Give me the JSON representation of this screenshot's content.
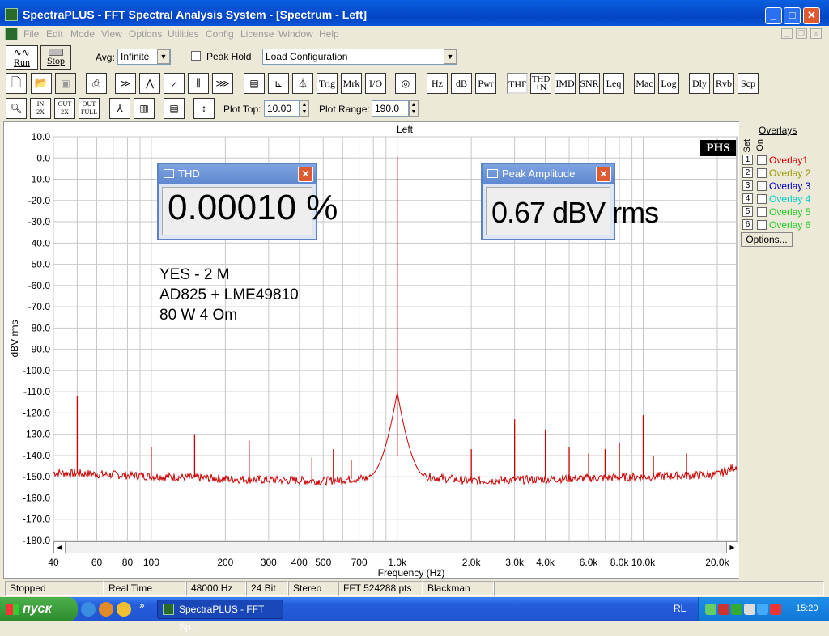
{
  "window": {
    "title": "SpectraPLUS - FFT Spectral Analysis System - [Spectrum - Left]",
    "minimize": "_",
    "maximize": "□",
    "close": "✕"
  },
  "menu": [
    "File",
    "Edit",
    "Mode",
    "View",
    "Options",
    "Utilities",
    "Config",
    "License",
    "Window",
    "Help"
  ],
  "toolbar1": {
    "run_label": "Run",
    "stop_label": "Stop",
    "avg_label": "Avg:",
    "avg_value": "Infinite",
    "peak_hold_label": "Peak Hold",
    "peak_hold_checked": false,
    "config_value": "Load Configuration"
  },
  "toolbar2": {
    "text_buttons": [
      "Trig",
      "Mrk",
      "I/O",
      "Hz",
      "dB",
      "Pwr",
      "THD",
      "IMD",
      "SNR",
      "Leq",
      "Mac",
      "Log",
      "Dly",
      "Rvb",
      "Scp"
    ],
    "thdn_line1": "THD",
    "thdn_line2": "+N"
  },
  "toolbar3": {
    "zoom_in": [
      "IN",
      "2X"
    ],
    "zoom_out": [
      "OUT",
      "2X"
    ],
    "zoom_full": [
      "OUT",
      "FULL"
    ],
    "plot_top_label": "Plot Top:",
    "plot_top_value": "10.00",
    "plot_range_label": "Plot Range:",
    "plot_range_value": "190.0"
  },
  "plot": {
    "channel_title": "Left",
    "badge": "PHS",
    "annotation": [
      "YES - 2 M",
      "AD825 + LME49810",
      "80 W   4 Om"
    ],
    "trace_color": "#cc0000"
  },
  "chart_data": {
    "type": "line",
    "title": "Left",
    "xlabel": "Frequency (Hz)",
    "ylabel": "dBV rms",
    "xscale": "log",
    "xlim": [
      40,
      24000
    ],
    "ylim": [
      -180,
      10
    ],
    "x_tick_labels": [
      {
        "v": 40,
        "t": "40"
      },
      {
        "v": 60,
        "t": "60"
      },
      {
        "v": 80,
        "t": "80"
      },
      {
        "v": 100,
        "t": "100"
      },
      {
        "v": 200,
        "t": "200"
      },
      {
        "v": 300,
        "t": "300"
      },
      {
        "v": 400,
        "t": "400"
      },
      {
        "v": 500,
        "t": "500"
      },
      {
        "v": 700,
        "t": "700"
      },
      {
        "v": 1000,
        "t": "1.0k"
      },
      {
        "v": 2000,
        "t": "2.0k"
      },
      {
        "v": 3000,
        "t": "3.0k"
      },
      {
        "v": 4000,
        "t": "4.0k"
      },
      {
        "v": 6000,
        "t": "6.0k"
      },
      {
        "v": 8000,
        "t": "8.0k"
      },
      {
        "v": 10000,
        "t": "10.0k"
      },
      {
        "v": 20000,
        "t": "20.0k"
      }
    ],
    "y_ticks": [
      10,
      0,
      -10,
      -20,
      -30,
      -40,
      -50,
      -60,
      -70,
      -80,
      -90,
      -100,
      -110,
      -120,
      -130,
      -140,
      -150,
      -160,
      -170,
      -180
    ],
    "y_tick_labels": [
      "10.0",
      "0.0",
      "-10.0",
      "-20.0",
      "-30.0",
      "-40.0",
      "-50.0",
      "-60.0",
      "-70.0",
      "-80.0",
      "-90.0",
      "-100.0",
      "-110.0",
      "-120.0",
      "-130.0",
      "-140.0",
      "-150.0",
      "-160.0",
      "-170.0",
      "-180.0"
    ],
    "noise_floor": [
      [
        40,
        -148
      ],
      [
        200,
        -151
      ],
      [
        500,
        -152
      ],
      [
        900,
        -150
      ],
      [
        1000,
        -140
      ],
      [
        1100,
        -149
      ],
      [
        2000,
        -152
      ],
      [
        10000,
        -150
      ],
      [
        20000,
        -149
      ],
      [
        24000,
        -145
      ]
    ],
    "peaks": [
      {
        "x": 50,
        "y": -112
      },
      {
        "x": 100,
        "y": -136
      },
      {
        "x": 150,
        "y": -130
      },
      {
        "x": 250,
        "y": -133
      },
      {
        "x": 450,
        "y": -141
      },
      {
        "x": 550,
        "y": -137
      },
      {
        "x": 650,
        "y": -142
      },
      {
        "x": 1000,
        "y": 0.7
      },
      {
        "x": 2000,
        "y": -137
      },
      {
        "x": 3000,
        "y": -123
      },
      {
        "x": 4000,
        "y": -128
      },
      {
        "x": 5000,
        "y": -136
      },
      {
        "x": 6000,
        "y": -139
      },
      {
        "x": 7000,
        "y": -137
      },
      {
        "x": 8000,
        "y": -134
      },
      {
        "x": 10000,
        "y": -121
      },
      {
        "x": 11000,
        "y": -140
      },
      {
        "x": 15000,
        "y": -139
      }
    ]
  },
  "overlays": {
    "title": "Overlays",
    "set_label": "Set",
    "on_label": "On",
    "items": [
      {
        "num": "1",
        "name": "Overlay1",
        "color": "#dd0000"
      },
      {
        "num": "2",
        "name": "Overlay 2",
        "color": "#999900"
      },
      {
        "num": "3",
        "name": "Overlay 3",
        "color": "#0000cc"
      },
      {
        "num": "4",
        "name": "Overlay 4",
        "color": "#00cccc"
      },
      {
        "num": "5",
        "name": "Overlay 5",
        "color": "#22cc22"
      },
      {
        "num": "6",
        "name": "Overlay 6",
        "color": "#22cc22"
      }
    ],
    "options_label": "Options..."
  },
  "meters": {
    "thd": {
      "title": "THD",
      "value": "0.00010 %"
    },
    "peak": {
      "title": "Peak Amplitude",
      "value": "0.67 dBV rms"
    }
  },
  "statusbar": [
    "Stopped",
    "Real Time",
    "48000 Hz",
    "24 Bit",
    "Stereo",
    "FFT 524288 pts",
    "Blackman"
  ],
  "taskbar": {
    "start_label": "пуск",
    "task_label": "SpectraPLUS - FFT Sp...",
    "lang": "RL",
    "clock": "15:20",
    "chevron": "»"
  }
}
